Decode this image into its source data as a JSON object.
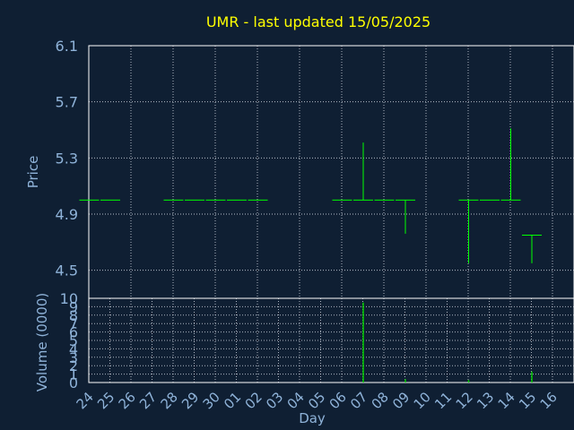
{
  "chart_data": {
    "type": "ohlc",
    "title": "UMR - last updated 15/05/2025",
    "xlabel": "Day",
    "ylabel": "Price",
    "volume_label": "Volume (0000)",
    "ylim": [
      4.3,
      6.1
    ],
    "yticks": [
      4.5,
      4.9,
      5.3,
      5.7,
      6.1
    ],
    "volume_ylim": [
      0,
      10
    ],
    "volume_yticks": [
      0,
      1,
      2,
      3,
      4,
      5,
      6,
      7,
      8,
      9,
      10
    ],
    "days": [
      "24",
      "25",
      "26",
      "27",
      "28",
      "29",
      "30",
      "01",
      "02",
      "03",
      "04",
      "05",
      "06",
      "07",
      "08",
      "09",
      "10",
      "11",
      "12",
      "13",
      "14",
      "15",
      "16"
    ],
    "bars": [
      {
        "day": "24",
        "open": 5.0,
        "high": 5.0,
        "low": 5.0,
        "close": 5.0,
        "volume": 0
      },
      {
        "day": "25",
        "open": 5.0,
        "high": 5.0,
        "low": 5.0,
        "close": 5.0,
        "volume": 0
      },
      {
        "day": "28",
        "open": 5.0,
        "high": 5.0,
        "low": 5.0,
        "close": 5.0,
        "volume": 0
      },
      {
        "day": "29",
        "open": 5.0,
        "high": 5.0,
        "low": 5.0,
        "close": 5.0,
        "volume": 0
      },
      {
        "day": "30",
        "open": 5.0,
        "high": 5.0,
        "low": 5.0,
        "close": 5.0,
        "volume": 0
      },
      {
        "day": "01",
        "open": 5.0,
        "high": 5.0,
        "low": 5.0,
        "close": 5.0,
        "volume": 0
      },
      {
        "day": "02",
        "open": 5.0,
        "high": 5.0,
        "low": 5.0,
        "close": 5.0,
        "volume": 0
      },
      {
        "day": "06",
        "open": 5.0,
        "high": 5.0,
        "low": 5.0,
        "close": 5.0,
        "volume": 0
      },
      {
        "day": "07",
        "open": 5.0,
        "high": 5.41,
        "low": 5.0,
        "close": 5.0,
        "volume": 9.5
      },
      {
        "day": "08",
        "open": 5.0,
        "high": 5.0,
        "low": 5.0,
        "close": 5.0,
        "volume": 0
      },
      {
        "day": "09",
        "open": 5.0,
        "high": 5.0,
        "low": 4.76,
        "close": 5.0,
        "volume": 0.4
      },
      {
        "day": "12",
        "open": 5.0,
        "high": 5.0,
        "low": 4.55,
        "close": 5.0,
        "volume": 0.3
      },
      {
        "day": "13",
        "open": 5.0,
        "high": 5.0,
        "low": 5.0,
        "close": 5.0,
        "volume": 0
      },
      {
        "day": "14",
        "open": 5.0,
        "high": 5.51,
        "low": 5.0,
        "close": 5.0,
        "volume": 0
      },
      {
        "day": "15",
        "open": 4.75,
        "high": 4.75,
        "low": 4.55,
        "close": 4.75,
        "volume": 1.3
      }
    ]
  }
}
